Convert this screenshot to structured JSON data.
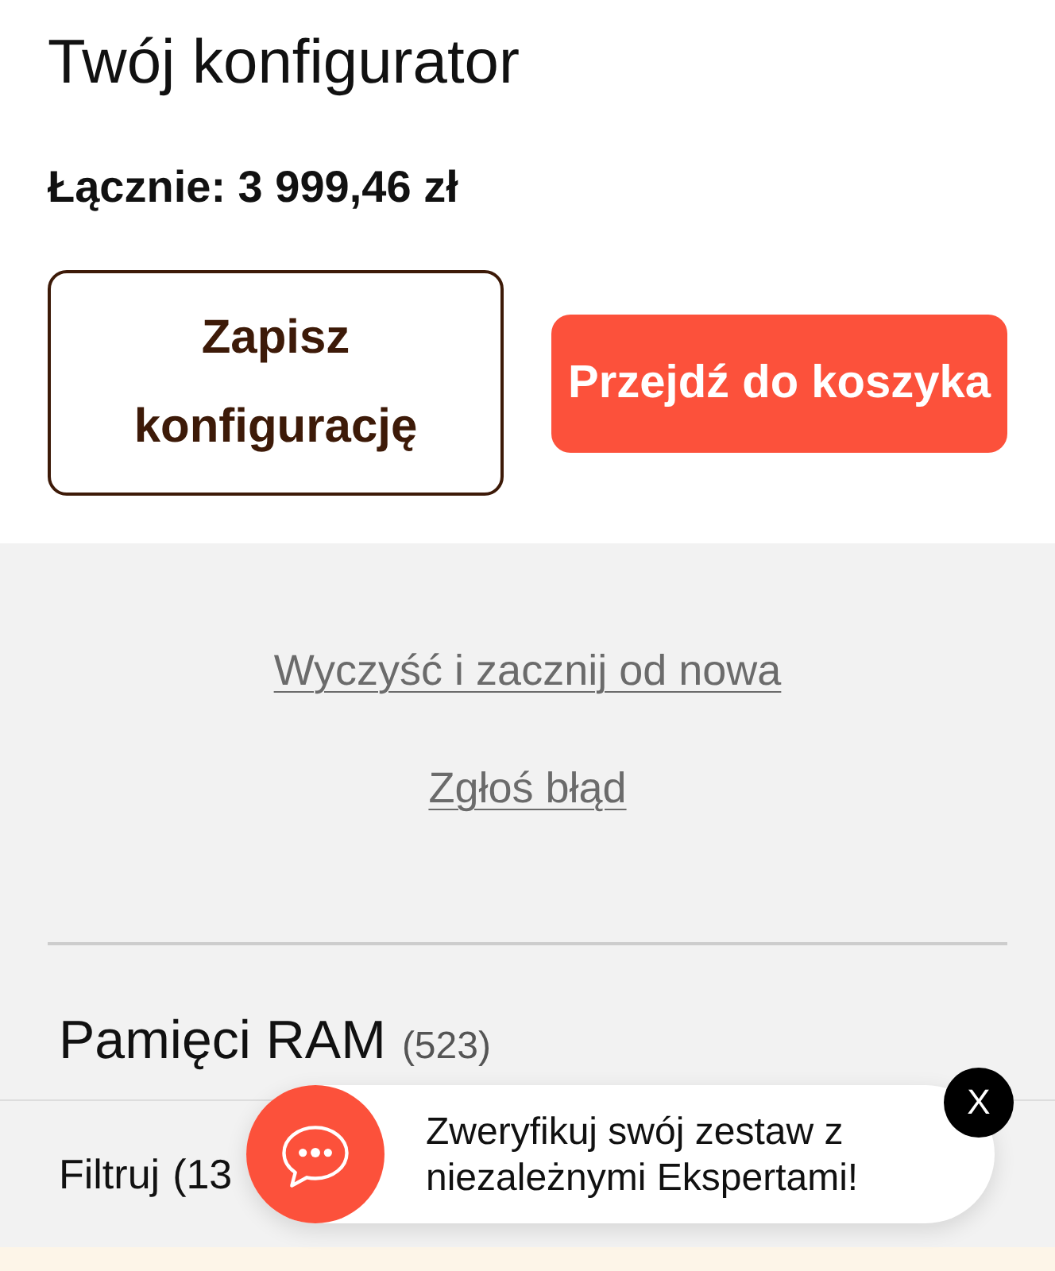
{
  "header": {
    "title": "Twój konfigurator",
    "total": "Łącznie: 3 999,46 zł"
  },
  "actions": [
    {
      "label": "Zapisz konfigurację",
      "kind": "outline"
    },
    {
      "label": "Przejdź do koszyka",
      "kind": "primary"
    }
  ],
  "links": [
    "Wyczyść i zacznij od nowa",
    "Zgłoś błąd"
  ],
  "category": {
    "name": "Pamięci RAM",
    "count": "(523)"
  },
  "filter": {
    "label": "Filtruj",
    "count": "(13"
  },
  "chat_popup": {
    "message": "Zweryfikuj swój zestaw z niezależnymi Ekspertami!",
    "close": "X"
  }
}
